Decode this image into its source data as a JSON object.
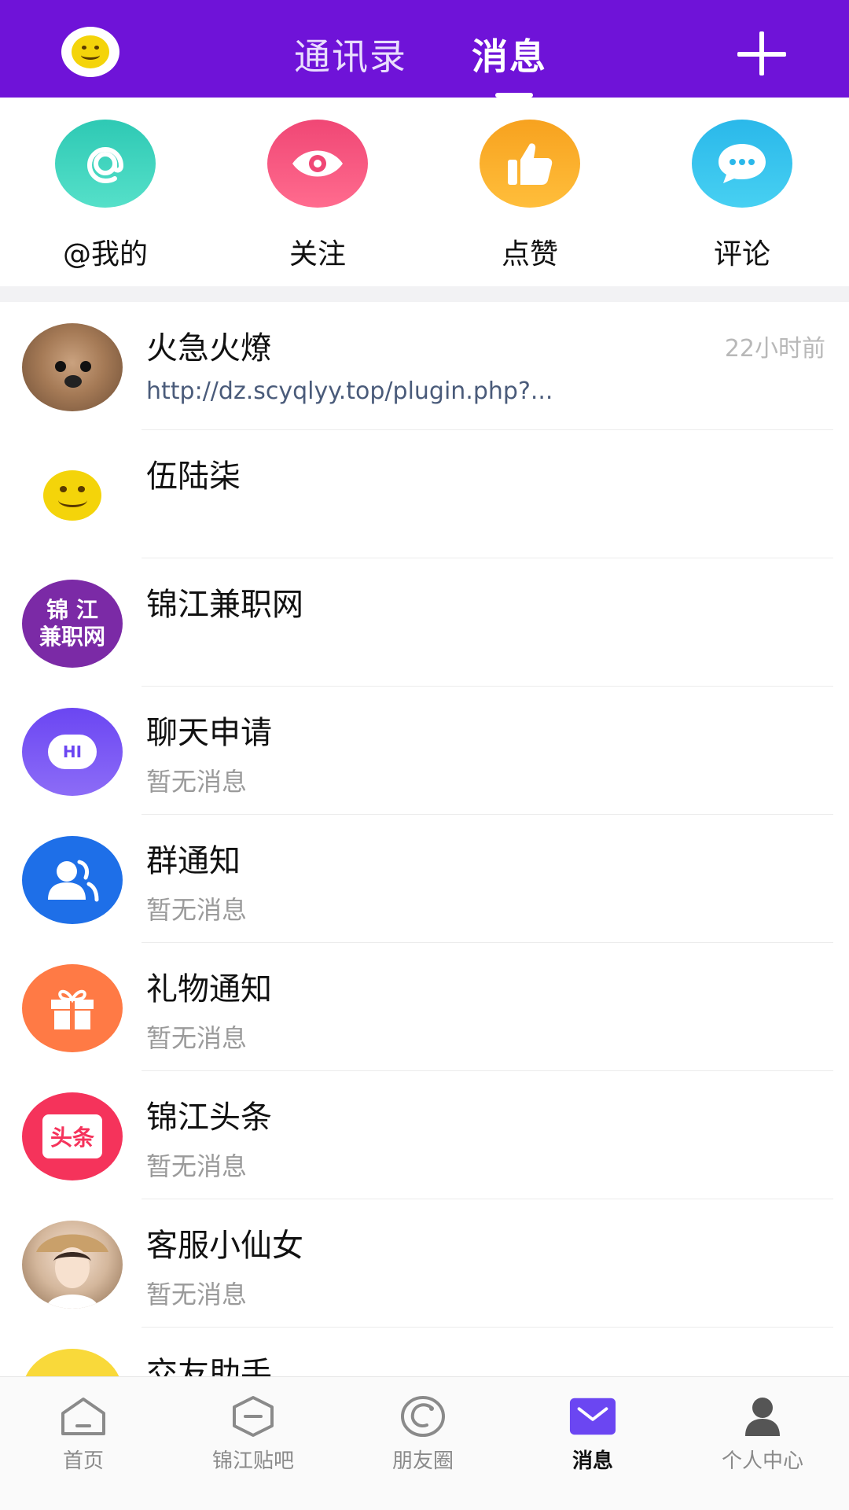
{
  "colors": {
    "header": "#6f13d8",
    "accent_active": "#6b46f2"
  },
  "header": {
    "tabs": [
      {
        "label": "通讯录"
      },
      {
        "label": "消息"
      }
    ],
    "active_tab": 1,
    "avatar_icon": "smiley-icon",
    "add_icon": "plus-icon"
  },
  "quick_actions": [
    {
      "label": "@我的",
      "icon": "at-icon"
    },
    {
      "label": "关注",
      "icon": "eye-icon"
    },
    {
      "label": "点赞",
      "icon": "thumbs-up-icon"
    },
    {
      "label": "评论",
      "icon": "comment-icon"
    }
  ],
  "conversations": [
    {
      "title": "火急火燎",
      "subtitle": "http://dz.scyqlyy.top/plugin.php?...",
      "time": "22小时前"
    },
    {
      "title": "伍陆柒",
      "subtitle": "",
      "time": ""
    },
    {
      "title": "锦江兼职网",
      "subtitle": "",
      "time": "",
      "avatar_text_1": "锦 江",
      "avatar_text_2": "兼职网"
    },
    {
      "title": "聊天申请",
      "subtitle": "暂无消息",
      "time": "",
      "avatar_text": "HI"
    },
    {
      "title": "群通知",
      "subtitle": "暂无消息",
      "time": ""
    },
    {
      "title": "礼物通知",
      "subtitle": "暂无消息",
      "time": ""
    },
    {
      "title": "锦江头条",
      "subtitle": "暂无消息",
      "time": "",
      "avatar_text": "头条"
    },
    {
      "title": "客服小仙女",
      "subtitle": "暂无消息",
      "time": ""
    },
    {
      "title": "交友助手",
      "subtitle": "",
      "time": ""
    }
  ],
  "bottom_nav": [
    {
      "label": "首页",
      "icon": "home-icon"
    },
    {
      "label": "锦江贴吧",
      "icon": "forum-icon"
    },
    {
      "label": "朋友圈",
      "icon": "moments-icon"
    },
    {
      "label": "消息",
      "icon": "mail-icon"
    },
    {
      "label": "个人中心",
      "icon": "person-icon"
    }
  ],
  "bottom_nav_active": 3
}
